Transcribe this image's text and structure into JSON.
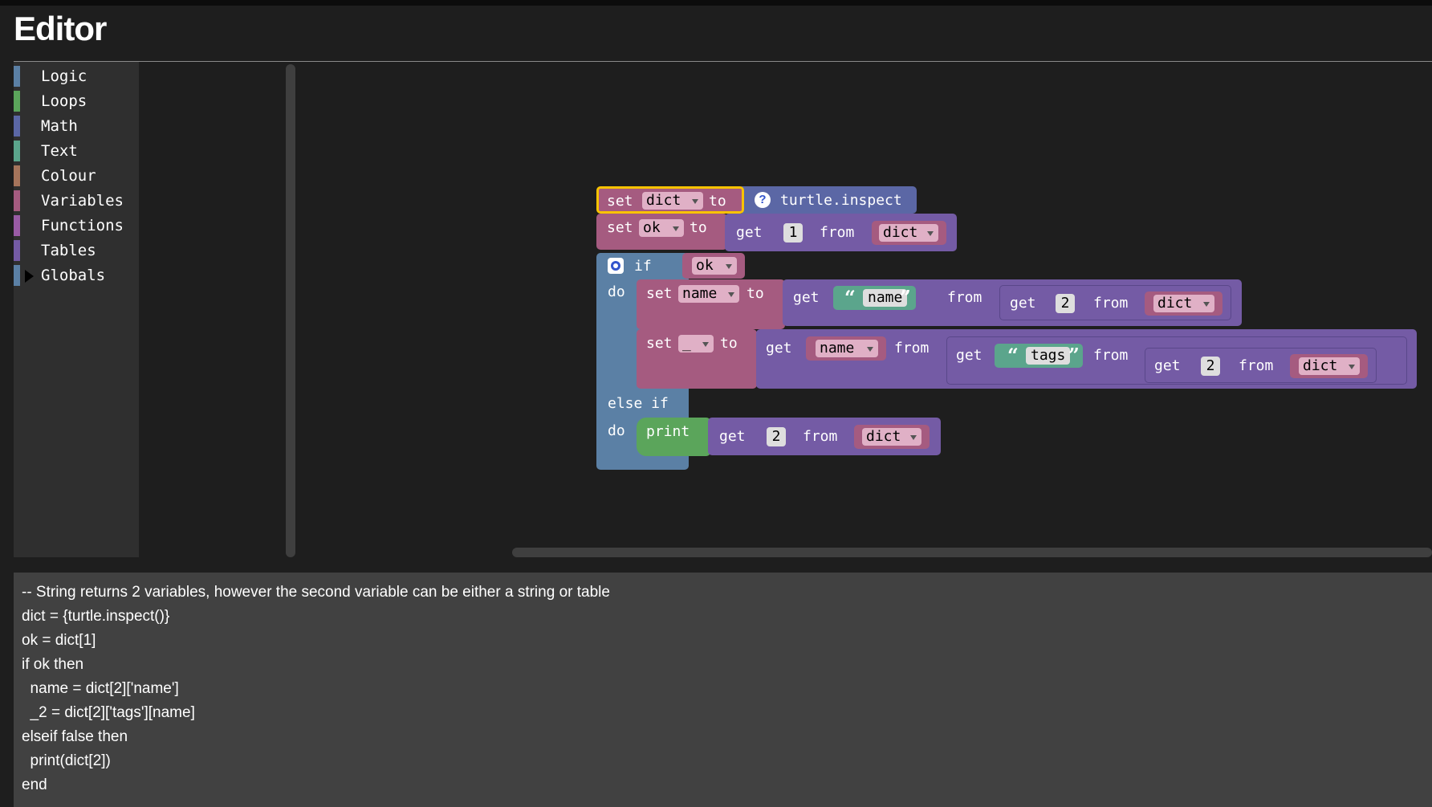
{
  "app": {
    "title": "Editor"
  },
  "colors": {
    "logic": "#5b80a5",
    "loops": "#5ba55b",
    "math": "#5b67a5",
    "text": "#5ba58c",
    "colour": "#a5745b",
    "variables": "#a55b80",
    "functions": "#995ba5",
    "tables": "#745ba5",
    "globals": "#5b80a5"
  },
  "toolbox": {
    "categories": [
      {
        "label": "Logic"
      },
      {
        "label": "Loops"
      },
      {
        "label": "Math"
      },
      {
        "label": "Text"
      },
      {
        "label": "Colour"
      },
      {
        "label": "Variables"
      },
      {
        "label": "Functions"
      },
      {
        "label": "Tables"
      },
      {
        "label": "Globals"
      }
    ]
  },
  "blocks": {
    "b1": {
      "set": "set",
      "var": "dict",
      "to": "to",
      "help": "?",
      "call": "turtle.inspect"
    },
    "b2": {
      "set": "set",
      "var": "ok",
      "to": "to",
      "get": "get",
      "index": "1",
      "from": "from",
      "list": "dict"
    },
    "b3": {
      "if": "if",
      "cond": "ok",
      "do": "do",
      "else_if": "else if",
      "do2": "do"
    },
    "b4": {
      "set": "set",
      "var": "name",
      "to": "to",
      "get": "get",
      "key": "name",
      "from": "from",
      "get2": "get",
      "index": "2",
      "from2": "from",
      "list": "dict"
    },
    "b5": {
      "set": "set",
      "var": "_",
      "to": "to",
      "get": "get",
      "key_var": "name",
      "from": "from",
      "get2": "get",
      "key": "tags",
      "from2": "from",
      "get3": "get",
      "index": "2",
      "from3": "from",
      "list": "dict"
    },
    "b6": {
      "print": "print",
      "get": "get",
      "index": "2",
      "from": "from",
      "list": "dict"
    }
  },
  "code": {
    "lines": [
      "-- String returns 2 variables, however the second variable can be either a string or table",
      "dict = {turtle.inspect()}",
      "ok = dict[1]",
      "if ok then",
      "  name = dict[2]['name']",
      "  _2 = dict[2]['tags'][name]",
      "elseif false then",
      "  print(dict[2])",
      "end"
    ]
  }
}
